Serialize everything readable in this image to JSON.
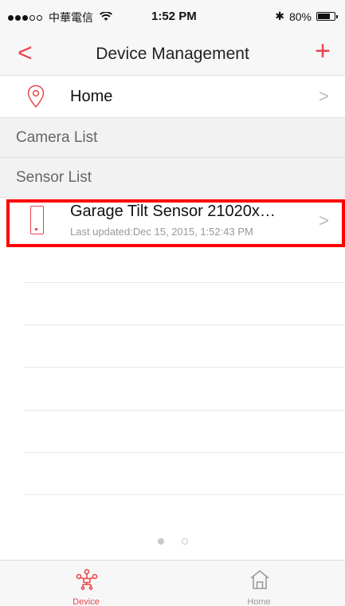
{
  "status_bar": {
    "carrier": "中華電信",
    "time": "1:52 PM",
    "bluetooth": "✱",
    "battery_text": "80%",
    "battery_level": 0.8
  },
  "nav": {
    "title": "Device Management",
    "back_symbol": "<",
    "add_symbol": "+"
  },
  "home_row": {
    "label": "Home"
  },
  "sections": {
    "camera_list": "Camera List",
    "sensor_list": "Sensor List"
  },
  "sensors": [
    {
      "name": "Garage Tilt Sensor 21020x…",
      "last_updated": "Last updated:Dec 15, 2015, 1:52:43 PM"
    }
  ],
  "pagination": {
    "pages": 2,
    "active": 1
  },
  "tab_bar": {
    "tabs": [
      {
        "label": "Device",
        "active": true
      },
      {
        "label": "Home",
        "active": false
      }
    ]
  },
  "colors": {
    "accent": "#e8474c",
    "highlight": "#ff0000"
  }
}
